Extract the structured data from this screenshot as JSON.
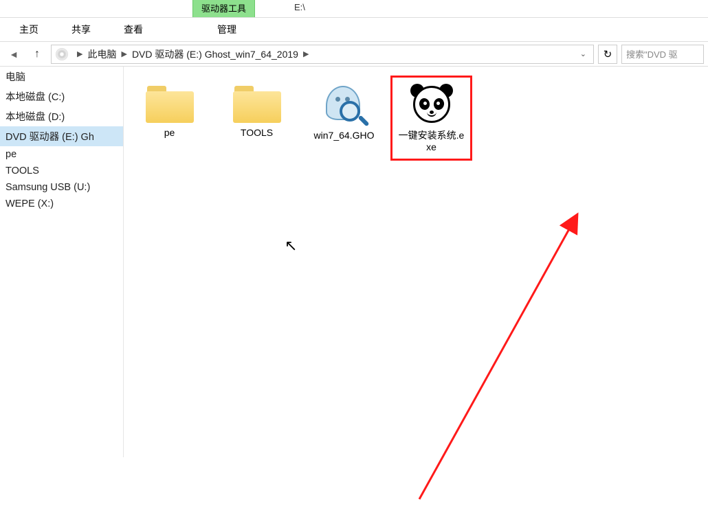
{
  "ribbon_tab": "驱动器工具",
  "drive_letter": "E:\\",
  "menu": {
    "home": "主页",
    "share": "共享",
    "view": "查看",
    "manage": "管理"
  },
  "breadcrumb": {
    "seg0": "此电脑",
    "seg1": "DVD 驱动器 (E:) Ghost_win7_64_2019"
  },
  "search_placeholder": "搜索\"DVD 驱",
  "sidebar": {
    "items": [
      {
        "label": "电脑"
      },
      {
        "label": "本地磁盘 (C:)"
      },
      {
        "label": "本地磁盘 (D:)"
      },
      {
        "label": "DVD 驱动器 (E:) Gh"
      },
      {
        "label": "pe"
      },
      {
        "label": "TOOLS"
      },
      {
        "label": "Samsung USB (U:)"
      },
      {
        "label": "WEPE (X:)"
      }
    ]
  },
  "files": {
    "f0": {
      "label": "pe"
    },
    "f1": {
      "label": "TOOLS"
    },
    "f2": {
      "label": "win7_64.GHO"
    },
    "f3": {
      "label": "一键安装系统.exe"
    }
  }
}
